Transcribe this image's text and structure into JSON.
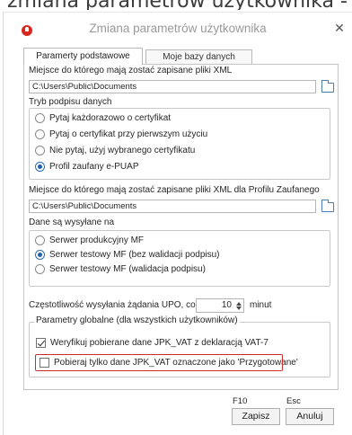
{
  "window": {
    "title": "Zmiana parametrów użytkownika",
    "background_title": "zmiana parametrów użytkownika - Parametr"
  },
  "tabs": [
    {
      "label": "Paramerty podstawowe",
      "active": true
    },
    {
      "label": "Moje bazy danych",
      "active": false
    }
  ],
  "xml_path": {
    "label": "Miejsce do którego mają zostać zapisane pliki XML",
    "value": "C:\\Users\\Public\\Documents"
  },
  "signature": {
    "label": "Tryb podpisu danych",
    "options": [
      {
        "label": "Pytaj każdorazowo o certyfikat",
        "checked": false
      },
      {
        "label": "Pytaj o certyfikat przy pierwszym użyciu",
        "checked": false
      },
      {
        "label": "Nie pytaj, użyj wybranego certyfikatu",
        "checked": false
      },
      {
        "label": "Profil zaufany e-PUAP",
        "checked": true
      }
    ]
  },
  "xml_path_trusted": {
    "label": "Miejsce do którego mają zostać zapisane pliki XML dla Profilu Zaufanego",
    "value": "C:\\Users\\Public\\Documents"
  },
  "send": {
    "label": "Dane są wysyłane na",
    "options": [
      {
        "label": "Serwer produkcyjny MF",
        "checked": false
      },
      {
        "label": "Serwer testowy MF (bez walidacji podpisu)",
        "checked": true
      },
      {
        "label": "Serwer testowy MF (walidacja podpisu)",
        "checked": false
      }
    ]
  },
  "upo": {
    "label": "Częstotliwość wysyłania żądania UPO, co:",
    "value": "10",
    "unit": "minut"
  },
  "global": {
    "legend": "Parametry globalne (dla wszystkich użytkowników)",
    "checkboxes": [
      {
        "label": "Weryfikuj pobierane dane JPK_VAT z deklaracją VAT-7",
        "checked": true
      },
      {
        "label": "Pobieraj tylko dane JPK_VAT oznaczone jako 'Przygotowane'",
        "checked": false
      }
    ]
  },
  "footer": {
    "save_shortcut": "F10",
    "save_label": "Zapisz",
    "cancel_shortcut": "Esc",
    "cancel_label": "Anuluj"
  },
  "colors": {
    "accent": "#1f5fae",
    "highlight": "#d22a2a",
    "app_icon": "#d8281e"
  }
}
